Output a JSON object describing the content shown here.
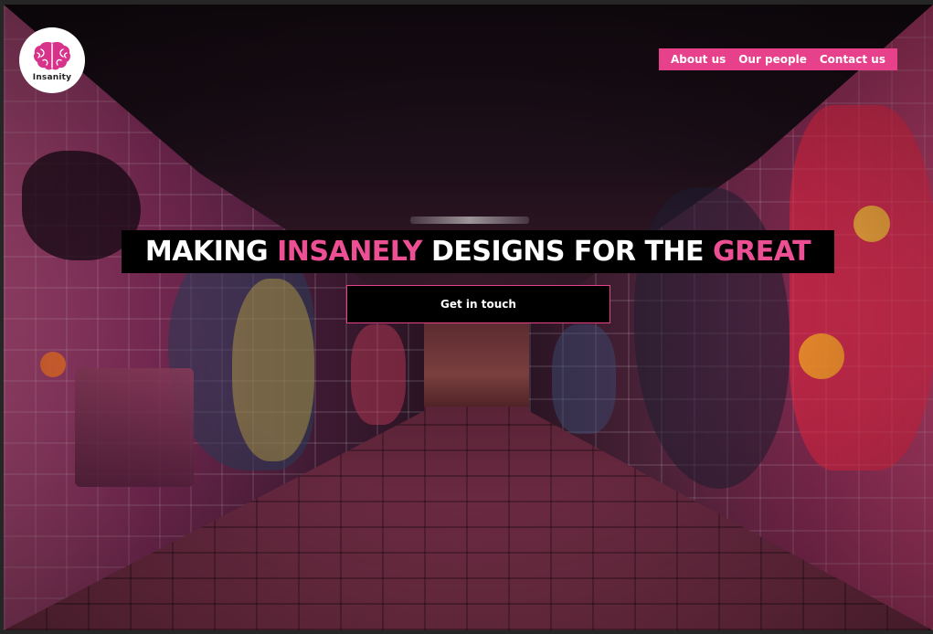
{
  "brand": {
    "logo_text": "Insanity",
    "logo_icon": "brain-icon",
    "accent_color": "#e8418b"
  },
  "nav": {
    "items": [
      {
        "label": "About us"
      },
      {
        "label": "Our people"
      },
      {
        "label": "Contact us"
      }
    ]
  },
  "hero": {
    "headline": {
      "part1": "MAKING",
      "part2": "INSANELY",
      "part3": "DESIGNS FOR THE",
      "part4": "GREAT"
    },
    "cta_label": "Get in touch",
    "background_image": "graffiti tunnel"
  }
}
